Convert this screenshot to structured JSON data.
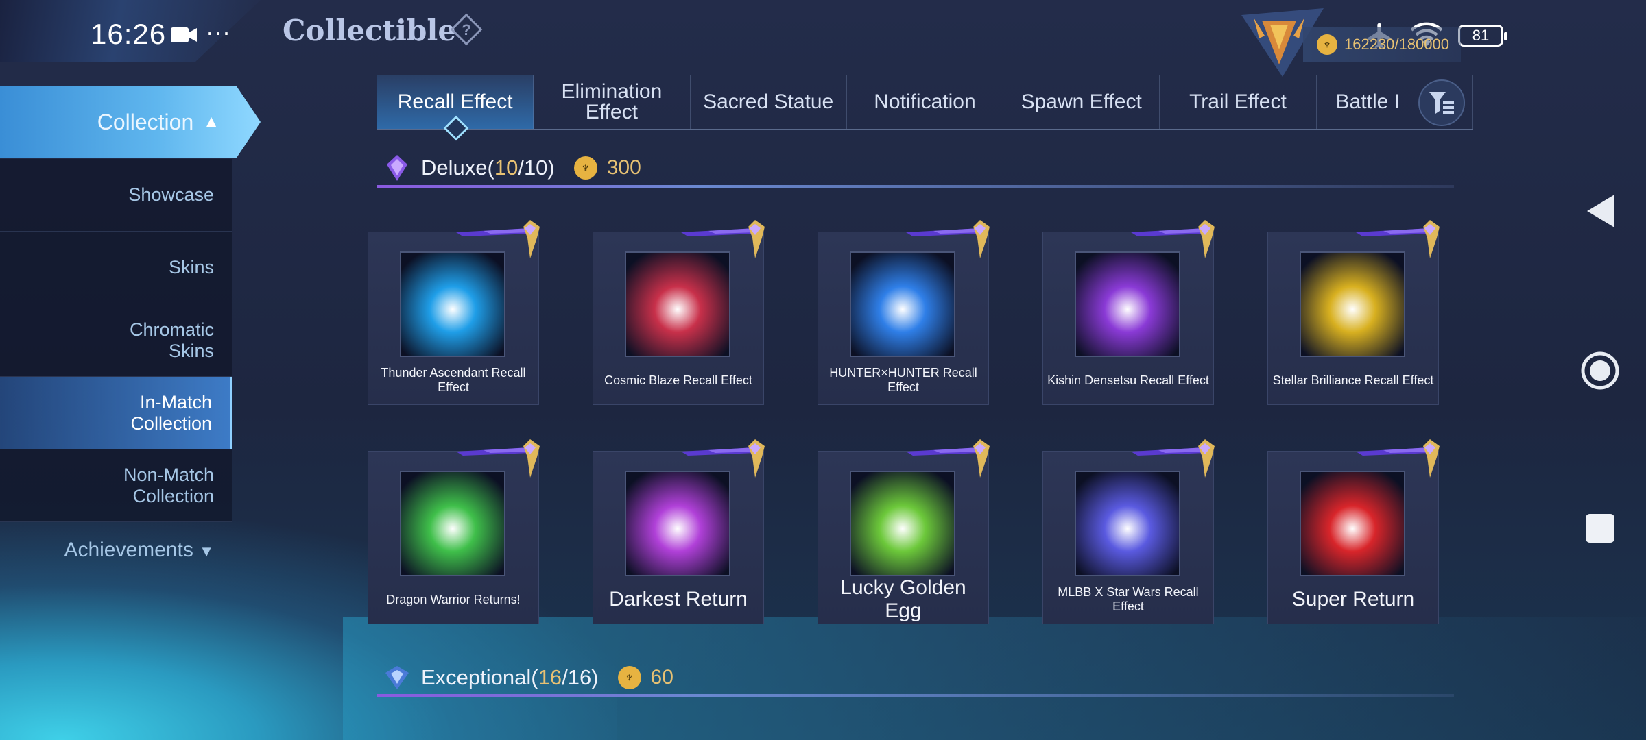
{
  "status": {
    "time": "16:26",
    "dots": "···",
    "battery": "81"
  },
  "header": {
    "title": "Collectible",
    "currency": "162230/180000"
  },
  "sidebar": {
    "collection_label": "Collection",
    "items": [
      {
        "label": "Showcase"
      },
      {
        "label": "Skins"
      },
      {
        "label": "Chromatic Skins"
      },
      {
        "label": "In-Match Collection"
      },
      {
        "label": "Non-Match Collection"
      }
    ],
    "achievements_label": "Achievements"
  },
  "tabs": [
    {
      "label": "Recall Effect"
    },
    {
      "label": "Elimination Effect"
    },
    {
      "label": "Sacred Statue"
    },
    {
      "label": "Notification"
    },
    {
      "label": "Spawn Effect"
    },
    {
      "label": "Trail Effect"
    },
    {
      "label": "Battle I"
    }
  ],
  "deluxe": {
    "title": "Deluxe",
    "owned": "10",
    "total": "10",
    "cost": "300"
  },
  "exceptional": {
    "title": "Exceptional",
    "owned": "16",
    "total": "16",
    "cost": "60"
  },
  "cards": [
    {
      "label": "Thunder Ascendant Recall Effect",
      "theme": "#1f9ee8"
    },
    {
      "label": "Cosmic Blaze Recall Effect",
      "theme": "#c8304a"
    },
    {
      "label": "HUNTER×HUNTER Recall Effect",
      "theme": "#2f7fe8"
    },
    {
      "label": "Kishin Densetsu Recall Effect",
      "theme": "#8a3ad6"
    },
    {
      "label": "Stellar Brilliance Recall Effect",
      "theme": "#d8b020"
    },
    {
      "label": "Dragon Warrior Returns!",
      "theme": "#3fbf4a"
    },
    {
      "label": "Darkest Return",
      "theme": "#b040d8"
    },
    {
      "label": "Lucky Golden Egg",
      "theme": "#6cc83a"
    },
    {
      "label": "MLBB X Star Wars Recall Effect",
      "theme": "#5a5ae0"
    },
    {
      "label": "Super Return",
      "theme": "#d8252a"
    }
  ]
}
